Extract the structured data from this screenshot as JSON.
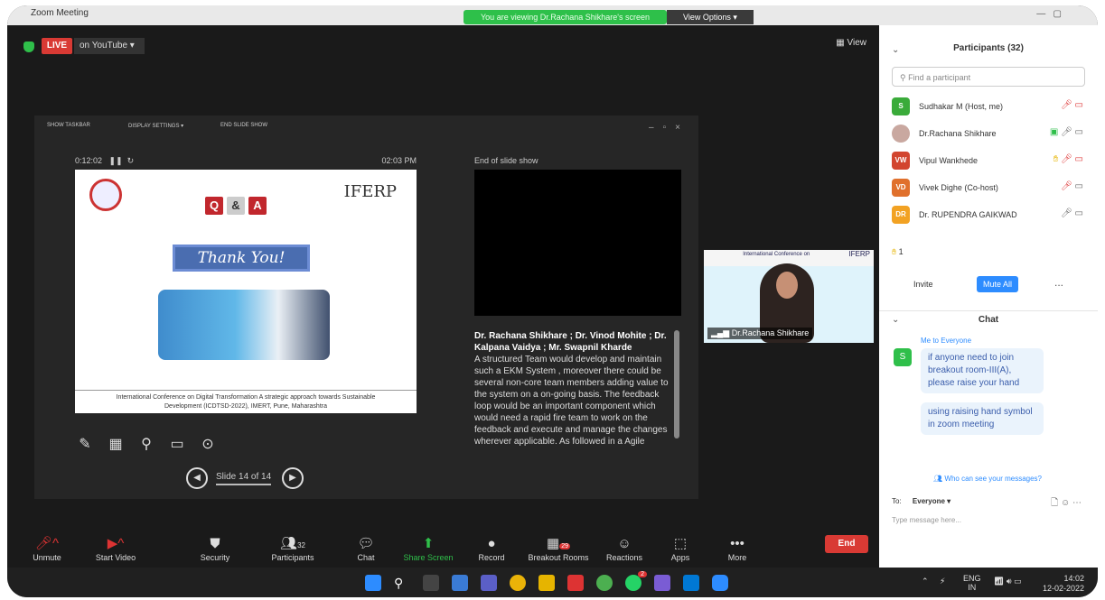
{
  "window": {
    "title": "Zoom Meeting",
    "viewing_banner": "You are viewing Dr.Rachana Shikhare's screen",
    "view_options": "View Options ▾"
  },
  "meeting": {
    "live_label": "LIVE",
    "live_dest": "on YouTube ▾",
    "view_label": "▦ View"
  },
  "presentation": {
    "toolbar": {
      "show_taskbar": "SHOW TASKBAR",
      "display_settings": "DISPLAY SETTINGS ▾",
      "end_show": "END SLIDE SHOW"
    },
    "elapsed": "0:12:02",
    "clock": "02:03 PM",
    "slide": {
      "qa": [
        "Q",
        "&",
        "A"
      ],
      "brand": "IFERP",
      "thanks": "Thank You!",
      "footer_line1": "International Conference on Digital Transformation A strategic approach towards Sustainable",
      "footer_line2": "Development (ICDTSD-2022), IMERT, Pune, Maharashtra"
    },
    "slide_counter": "Slide 14 of 14",
    "end_label": "End of slide show",
    "notes_authors": "Dr. Rachana Shikhare ; Dr. Vinod Mohite ; Dr. Kalpana Vaidya ; Mr. Swapnil Kharde",
    "notes_body": "A structured Team would develop and maintain such a EKM System , moreover there could be several non-core team members adding value to the system on a on-going basis. The feedback loop would be an important component which would need a rapid fire team to work on the feedback and execute and manage the changes wherever applicable. As followed in a Agile"
  },
  "video": {
    "name": "Dr.Rachana Shikhare",
    "banner_title": "International Conference on",
    "banner_brand": "IFERP"
  },
  "toolbar": {
    "unmute": "Unmute",
    "start_video": "Start Video",
    "security": "Security",
    "participants": "Participants",
    "participants_count": "32",
    "chat": "Chat",
    "share_screen": "Share Screen",
    "record": "Record",
    "breakout_rooms": "Breakout Rooms",
    "breakout_badge": "29",
    "reactions": "Reactions",
    "apps": "Apps",
    "more": "More",
    "end": "End"
  },
  "sidebar": {
    "participants_title": "Participants (32)",
    "find_placeholder": "Find a participant",
    "participants": [
      {
        "initials": "S",
        "name": "Sudhakar M (Host, me)",
        "color": "#3aab3a"
      },
      {
        "initials": "",
        "name": "Dr.Rachana Shikhare",
        "color": "#b99"
      },
      {
        "initials": "VW",
        "name": "Vipul Wankhede",
        "color": "#d2452f"
      },
      {
        "initials": "VD",
        "name": "Vivek Dighe (Co-host)",
        "color": "#e0702c"
      },
      {
        "initials": "DR",
        "name": "Dr. RUPENDRA GAIKWAD",
        "color": "#f2a223"
      }
    ],
    "raised_count": "1",
    "invite": "Invite",
    "mute_all": "Mute All",
    "more": "...",
    "chat_title": "Chat",
    "chat_to": "Me to Everyone",
    "chat_sender_initial": "S",
    "messages": [
      "if anyone need to join breakout room-III(A), please raise your hand",
      "using raising hand symbol in zoom meeting"
    ],
    "who_can_see": "Who can see your messages?",
    "to_label": "To:",
    "to_value": "Everyone ▾",
    "type_placeholder": "Type message here..."
  },
  "taskbar": {
    "lang": "ENG",
    "region": "IN",
    "time": "14:02",
    "date": "12-02-2022",
    "whatsapp_badge": "2"
  }
}
